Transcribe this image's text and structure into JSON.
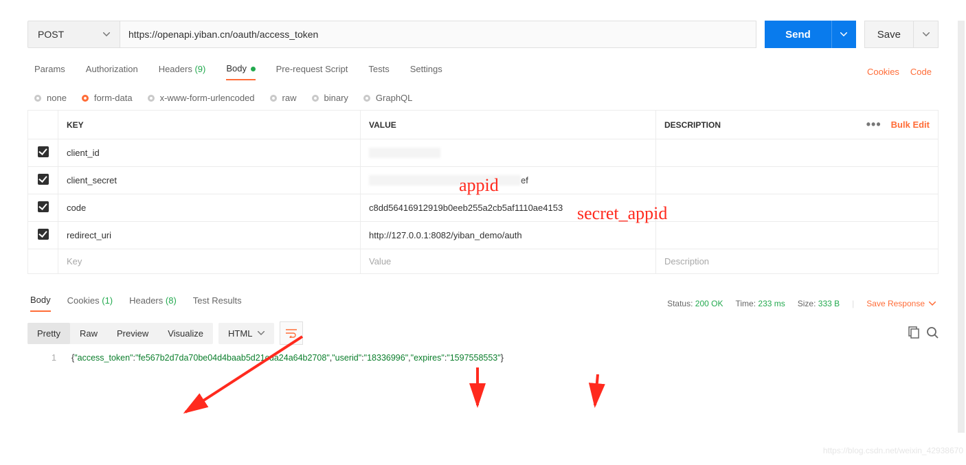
{
  "request": {
    "method": "POST",
    "url": "https://openapi.yiban.cn/oauth/access_token",
    "sendLabel": "Send",
    "saveLabel": "Save"
  },
  "reqTabs": {
    "params": "Params",
    "authorization": "Authorization",
    "headers": "Headers",
    "headersCount": "(9)",
    "body": "Body",
    "prerequest": "Pre-request Script",
    "tests": "Tests",
    "settings": "Settings",
    "cookies": "Cookies",
    "code": "Code"
  },
  "bodyTypes": {
    "none": "none",
    "formdata": "form-data",
    "xwww": "x-www-form-urlencoded",
    "raw": "raw",
    "binary": "binary",
    "graphql": "GraphQL"
  },
  "tableHead": {
    "key": "KEY",
    "value": "VALUE",
    "description": "DESCRIPTION",
    "bulk": "Bulk Edit"
  },
  "rows": [
    {
      "key": "client_id",
      "value": "",
      "desc": ""
    },
    {
      "key": "client_secret",
      "value": "ef",
      "desc": ""
    },
    {
      "key": "code",
      "value": "c8dd56416912919b0eeb255a2cb5af1110ae4153",
      "desc": ""
    },
    {
      "key": "redirect_uri",
      "value": "http://127.0.0.1:8082/yiban_demo/auth",
      "desc": ""
    }
  ],
  "emptyRow": {
    "keyPh": "Key",
    "valuePh": "Value",
    "descPh": "Description"
  },
  "respTabs": {
    "body": "Body",
    "cookies": "Cookies",
    "cookiesCount": "(1)",
    "headers": "Headers",
    "headersCount": "(8)",
    "testResults": "Test Results"
  },
  "status": {
    "statusLabel": "Status:",
    "statusVal": "200 OK",
    "timeLabel": "Time:",
    "timeVal": "233 ms",
    "sizeLabel": "Size:",
    "sizeVal": "333 B",
    "saveResponse": "Save Response"
  },
  "viewModes": {
    "pretty": "Pretty",
    "raw": "Raw",
    "preview": "Preview",
    "visualize": "Visualize",
    "lang": "HTML"
  },
  "response": {
    "lineNo": "1",
    "json_parts": {
      "open": "{",
      "k1": "\"access_token\"",
      "c": ":",
      "v1": "\"fe567b2d7da70be04d4baab5d21cda24a64b2708\"",
      "sep": ",",
      "k2": "\"userid\"",
      "v2": "\"18336996\"",
      "k3": "\"expires\"",
      "v3": "\"1597558553\"",
      "close": "}"
    }
  },
  "annotations": {
    "appid": "appid",
    "secret": "secret_appid"
  },
  "watermark": "https://blog.csdn.net/weixin_42938670"
}
